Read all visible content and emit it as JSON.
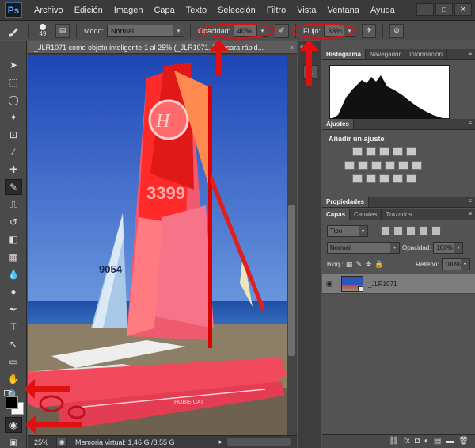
{
  "app": {
    "logo": "Ps",
    "menu": [
      "Archivo",
      "Edición",
      "Imagen",
      "Capa",
      "Texto",
      "Selección",
      "Filtro",
      "Vista",
      "Ventana",
      "Ayuda"
    ],
    "window_controls": [
      "–",
      "□",
      "✕"
    ]
  },
  "options_bar": {
    "brush_size": "49",
    "mode_label": "Modo:",
    "mode_value": "Normal",
    "opacity_label": "Opacidad:",
    "opacity_value": "40%",
    "flow_label": "Flujo:",
    "flow_value": "33%",
    "icons": [
      "brush-tool-icon",
      "brush-panel-toggle-icon",
      "airbrush-icon",
      "pressure-size-icon"
    ]
  },
  "document": {
    "tab_title": "_JLR1071 como objeto inteligente-1 al 25% (_JLR1071, Máscara rápid...",
    "close_glyph": "×",
    "zoom": "25%",
    "status": "Memoria virtual: 1,46 G /8,55 G",
    "status_arrow": "▸"
  },
  "toolbar": {
    "tools": [
      "move-tool-icon",
      "marquee-tool-icon",
      "lasso-tool-icon",
      "quick-selection-icon",
      "crop-tool-icon",
      "eyedropper-icon",
      "healing-brush-icon",
      "brush-tool-icon",
      "clone-stamp-icon",
      "history-brush-icon",
      "eraser-icon",
      "gradient-icon",
      "blur-icon",
      "dodge-icon",
      "pen-icon",
      "type-icon",
      "path-selection-icon",
      "rectangle-icon",
      "hand-icon",
      "zoom-icon"
    ],
    "tool_glyphs": [
      "➤",
      "⬚",
      "◯",
      "✦",
      "⊡",
      "⁄",
      "✚",
      "✎",
      "⎍",
      "↺",
      "◧",
      "▦",
      "💧",
      "●",
      "✒",
      "T",
      "↖",
      "▭",
      "✋",
      "🔍"
    ],
    "foreground_color": "#000000",
    "background_color": "#ffffff",
    "quick_mask_glyph": "◉",
    "screen_mode_glyph": "▣"
  },
  "panels": {
    "collapse_glyph": "«",
    "menu_glyph": "≡",
    "top_tabs": [
      "Histograma",
      "Navegador",
      "Información"
    ],
    "adjustments_tab": "Ajustes",
    "adjustments_title": "Añadir un ajuste",
    "properties_tab": "Propiedades",
    "layers_tabs": [
      "Capas",
      "Canales",
      "Trazados"
    ],
    "filter_kind": "Tipo",
    "blend_mode": "Normal",
    "opacity_label": "Opacidad:",
    "opacity_value": "100%",
    "lock_label": "Bloq.:",
    "fill_label": "Relleno:",
    "fill_value": "100%",
    "layer_name": "_JLR1071",
    "eye_glyph": "◉",
    "lock_glyphs": [
      "▦",
      "✎",
      "✥",
      "🔒"
    ],
    "footer_glyphs": [
      "⛓",
      "fx",
      "◘",
      "◐",
      "▤",
      "▬",
      "🗑"
    ],
    "mini_glyph": "▭",
    "dd_arrow": "▾"
  },
  "colors": {
    "annotation_red": "#e01010",
    "ui_dark": "#3a3a3a",
    "panel_bg": "#535353",
    "mask_overlay": "rgba(255,0,0,0.5)"
  }
}
